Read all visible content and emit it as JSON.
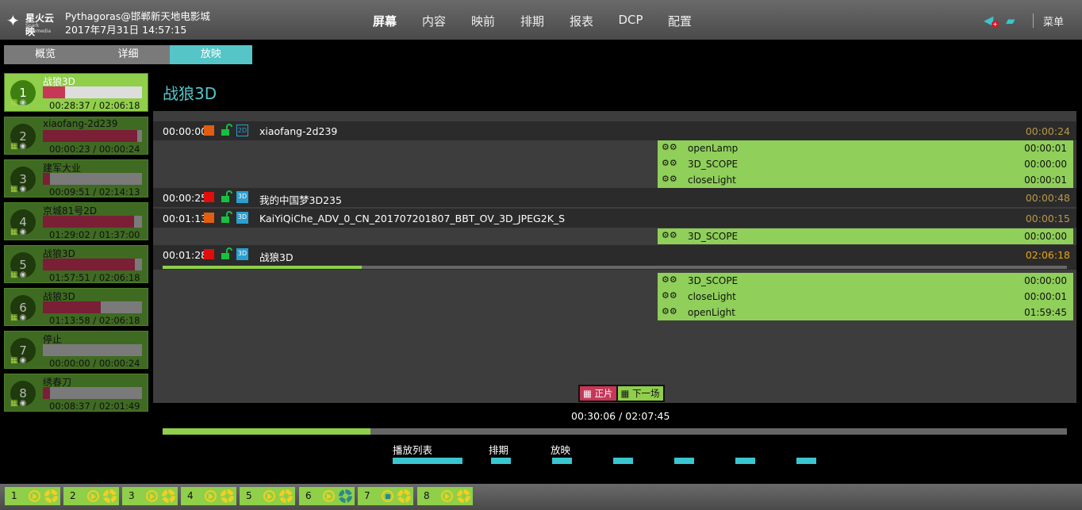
{
  "header": {
    "logo_text": "星火云映",
    "logo_sub": "Spark Cinemedia",
    "user": "Pythagoras@邯郸新天地电影城",
    "datetime": "2017年7月31日 14:57:15",
    "nav": [
      "屏幕",
      "内容",
      "映前",
      "排期",
      "报表",
      "DCP",
      "配置"
    ],
    "active_nav": "屏幕",
    "menu_label": "菜单",
    "icons": [
      "speaker-alert-icon",
      "chat-icon"
    ]
  },
  "subtabs": [
    "概览",
    "详细",
    "放映"
  ],
  "active_subtab": "放映",
  "screens": [
    {
      "num": "1",
      "title": "战狼3D",
      "progress": 0.22,
      "time": "00:28:37 / 02:06:18",
      "active": true
    },
    {
      "num": "2",
      "title": "xiaofang-2d239",
      "progress": 0.95,
      "time": "00:00:23 / 00:00:24",
      "active": false
    },
    {
      "num": "3",
      "title": "建军大业",
      "progress": 0.07,
      "time": "00:09:51 / 02:14:13",
      "active": false
    },
    {
      "num": "4",
      "title": "京城81号2D",
      "progress": 0.92,
      "time": "01:29:02 / 01:37:00",
      "active": false
    },
    {
      "num": "5",
      "title": "战狼3D",
      "progress": 0.93,
      "time": "01:57:51 / 02:06:18",
      "active": false
    },
    {
      "num": "6",
      "title": "战狼3D",
      "progress": 0.58,
      "time": "01:13:58 / 02:06:18",
      "active": false
    },
    {
      "num": "7",
      "title": "停止",
      "progress": 0.0,
      "time": "00:00:00 / 00:00:24",
      "active": false
    },
    {
      "num": "8",
      "title": "绣春刀",
      "progress": 0.07,
      "time": "00:08:37 / 02:01:49",
      "active": false
    }
  ],
  "main": {
    "title": "战狼3D",
    "rows": [
      {
        "time": "00:00:00",
        "status": "orange",
        "format": "2D",
        "name": "xiaofang-2d239",
        "duration": "00:00:24"
      },
      {
        "time": "00:00:25",
        "status": "red",
        "format": "3D",
        "name": "我的中国梦3D235",
        "duration": "00:00:48"
      },
      {
        "time": "00:01:13",
        "status": "orange",
        "format": "3D",
        "name": "KaiYiQiChe_ADV_0_CN_20170720180​7_BBT_OV_3D_JPEG2K_S",
        "duration": "00:00:15"
      },
      {
        "time": "00:01:28",
        "status": "red",
        "format": "3D",
        "name": "战狼3D",
        "duration": "02:06:18"
      }
    ],
    "cues_group1": [
      {
        "name": "openLamp",
        "time": "00:00:01"
      },
      {
        "name": "3D_SCOPE",
        "time": "00:00:00"
      },
      {
        "name": "closeLight",
        "time": "00:00:01"
      }
    ],
    "cues_group2": [
      {
        "name": "3D_SCOPE",
        "time": "00:00:00"
      }
    ],
    "cues_group3": [
      {
        "name": "3D_SCOPE",
        "time": "00:00:00"
      },
      {
        "name": "closeLight",
        "time": "00:00:01"
      },
      {
        "name": "openLight",
        "time": "01:59:45"
      }
    ],
    "current_progress": 0.22,
    "legend": {
      "feature": "正片",
      "next": "下一场"
    },
    "timecode": "00:30:06 / 02:07:45",
    "overall_progress": 0.23
  },
  "controls": {
    "labels": [
      "播放列表",
      "排期",
      "放映"
    ]
  },
  "bottom_screens": [
    {
      "num": "1",
      "state": "play"
    },
    {
      "num": "2",
      "state": "play"
    },
    {
      "num": "3",
      "state": "play"
    },
    {
      "num": "4",
      "state": "play"
    },
    {
      "num": "5",
      "state": "play"
    },
    {
      "num": "6",
      "state": "play-teal"
    },
    {
      "num": "7",
      "state": "stop"
    },
    {
      "num": "8",
      "state": "play"
    }
  ],
  "colors": {
    "accent": "#55c5c8",
    "active_green": "#8fcf4a",
    "card_green": "#3f6a22",
    "progress_red": "#c73758",
    "duration_gold": "#b8974a"
  }
}
